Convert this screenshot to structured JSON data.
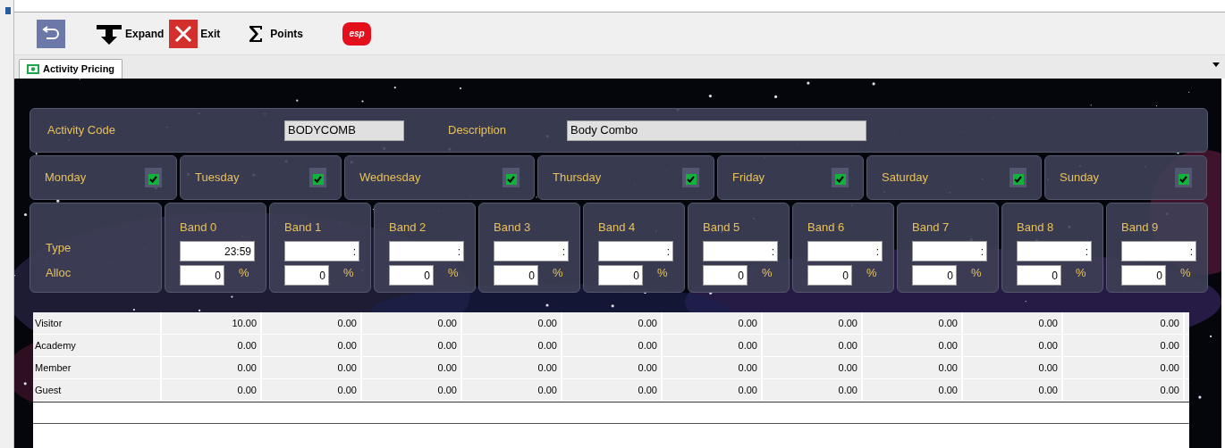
{
  "toolbar": [
    {
      "kind": "undo"
    },
    {
      "kind": "expand",
      "label": "Expand"
    },
    {
      "kind": "exit",
      "label": "Exit"
    },
    {
      "kind": "sum",
      "label": "Points"
    },
    {
      "kind": "logo",
      "label": "esp"
    }
  ],
  "tabs": [
    {
      "label": "Activity Pricing",
      "selected": true
    }
  ],
  "header": {
    "code_label": "Activity Code",
    "code_value": "BODYCOMB",
    "description_label": "Description",
    "description_value": "Body Combo"
  },
  "days": [
    {
      "label": "Monday",
      "checked": true
    },
    {
      "label": "Tuesday",
      "checked": true
    },
    {
      "label": "Wednesday",
      "checked": true
    },
    {
      "label": "Thursday",
      "checked": true
    },
    {
      "label": "Friday",
      "checked": true
    },
    {
      "label": "Saturday",
      "checked": true
    },
    {
      "label": "Sunday",
      "checked": true
    }
  ],
  "band_row_labels": [
    "Type",
    "Alloc"
  ],
  "bands": [
    {
      "label": "Band 0",
      "type": "23:59",
      "alloc": "0",
      "unit": "%"
    },
    {
      "label": "Band 1",
      "type": ":",
      "alloc": "0",
      "unit": "%"
    },
    {
      "label": "Band 2",
      "type": ":",
      "alloc": "0",
      "unit": "%"
    },
    {
      "label": "Band 3",
      "type": ":",
      "alloc": "0",
      "unit": "%"
    },
    {
      "label": "Band 4",
      "type": ":",
      "alloc": "0",
      "unit": "%"
    },
    {
      "label": "Band 5",
      "type": ":",
      "alloc": "0",
      "unit": "%"
    },
    {
      "label": "Band 6",
      "type": ":",
      "alloc": "0",
      "unit": "%"
    },
    {
      "label": "Band 7",
      "type": ":",
      "alloc": "0",
      "unit": "%"
    },
    {
      "label": "Band 8",
      "type": ":",
      "alloc": "0",
      "unit": "%"
    },
    {
      "label": "Band 9",
      "type": ":",
      "alloc": "0",
      "unit": "%"
    }
  ],
  "table": {
    "rows": [
      {
        "name": "Visitor",
        "values": [
          "10.00",
          "0.00",
          "0.00",
          "0.00",
          "0.00",
          "0.00",
          "0.00",
          "0.00",
          "0.00",
          "0.00"
        ]
      },
      {
        "name": "Academy",
        "values": [
          "0.00",
          "0.00",
          "0.00",
          "0.00",
          "0.00",
          "0.00",
          "0.00",
          "0.00",
          "0.00",
          "0.00"
        ]
      },
      {
        "name": "Member",
        "values": [
          "0.00",
          "0.00",
          "0.00",
          "0.00",
          "0.00",
          "0.00",
          "0.00",
          "0.00",
          "0.00",
          "0.00"
        ]
      },
      {
        "name": "Guest",
        "values": [
          "0.00",
          "0.00",
          "0.00",
          "0.00",
          "0.00",
          "0.00",
          "0.00",
          "0.00",
          "0.00",
          "0.00"
        ]
      }
    ]
  }
}
